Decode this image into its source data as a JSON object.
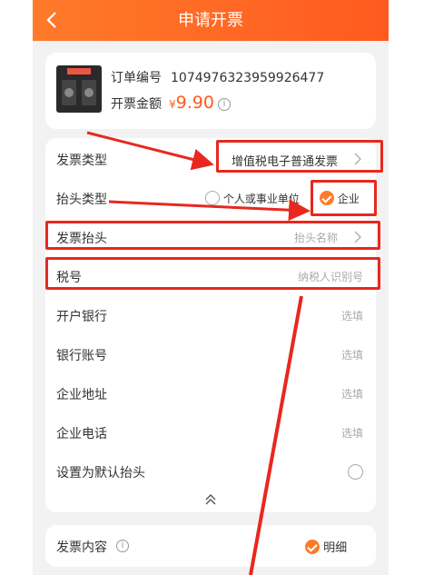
{
  "header": {
    "title": "申请开票"
  },
  "order": {
    "number_label": "订单编号",
    "number_value": "1074976323959926477",
    "amount_label": "开票金额",
    "currency": "¥",
    "amount_value": "9.90"
  },
  "form": {
    "invoice_type": {
      "label": "发票类型",
      "value": "增值税电子普通发票"
    },
    "title_type": {
      "label": "抬头类型",
      "option_personal": "个人或事业单位",
      "option_company": "企业"
    },
    "invoice_title": {
      "label": "发票抬头",
      "placeholder": "抬头名称"
    },
    "tax_id": {
      "label": "税号",
      "placeholder": "纳税人识别号"
    },
    "bank": {
      "label": "开户银行",
      "placeholder": "选填"
    },
    "account": {
      "label": "银行账号",
      "placeholder": "选填"
    },
    "address": {
      "label": "企业地址",
      "placeholder": "选填"
    },
    "phone": {
      "label": "企业电话",
      "placeholder": "选填"
    },
    "default_title": {
      "label": "设置为默认抬头"
    }
  },
  "content": {
    "label": "发票内容",
    "option": "明细"
  },
  "colors": {
    "accent": "#ff5a1f",
    "annotation": "#e8281e"
  }
}
